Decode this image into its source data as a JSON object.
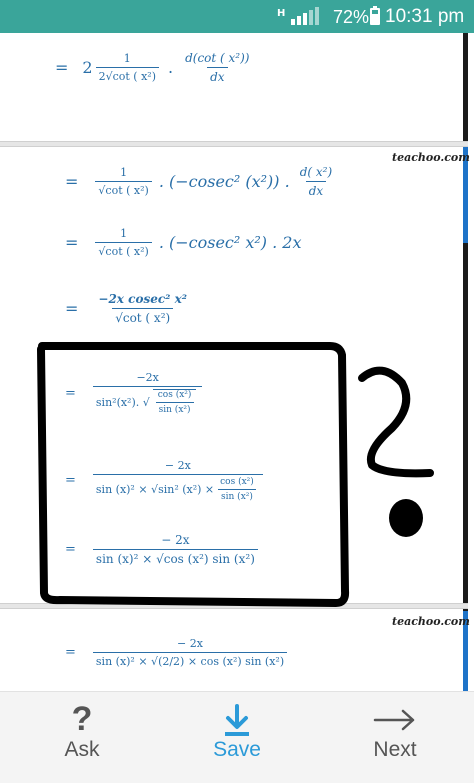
{
  "status_bar": {
    "network": "H",
    "battery_percent": "72%",
    "battery_level": 0.72,
    "time": "10:31 pm"
  },
  "content": {
    "watermark": "teachoo.com",
    "lines": {
      "l1": {
        "coef": "2",
        "num": "1",
        "den": "2√cot ( x²)",
        "dnum": "d(cot ( x²))",
        "dden": "dx"
      },
      "l2": {
        "num": "1",
        "den": "√cot ( x²)",
        "mid": ". (−cosec² (x²)) .",
        "dnum": "d( x²)",
        "dden": "dx"
      },
      "l3": {
        "num": "1",
        "den": "√cot ( x²)",
        "mid": ". (−cosec² x²) . 2x"
      },
      "l4": {
        "num": "−2x cosec² x²",
        "den": "√cot ( x²)"
      },
      "l5": {
        "num": "−2x",
        "den_a": "sin²(x²). √",
        "den_b_num": "cos (x²)",
        "den_b_den": "sin (x²)"
      },
      "l6": {
        "num": "− 2x",
        "den_a": "sin (x)² × √sin²  (x²) ×",
        "den_b_num": "cos  (x²)",
        "den_b_den": "sin  (x²)"
      },
      "l7": {
        "num": "− 2x",
        "den": "sin (x)² × √cos  (x²) sin  (x²)"
      },
      "l8": {
        "num": "− 2x",
        "den": "sin (x)² × √(2/2) × cos  (x²) sin  (x²)"
      }
    },
    "equals": "="
  },
  "bottom_nav": {
    "ask": {
      "label": "Ask",
      "icon": "?"
    },
    "save": {
      "label": "Save"
    },
    "next": {
      "label": "Next"
    }
  },
  "colors": {
    "status_bar": "#3aa59a",
    "math": "#2a6fa8",
    "save_accent": "#2b9ad8"
  }
}
